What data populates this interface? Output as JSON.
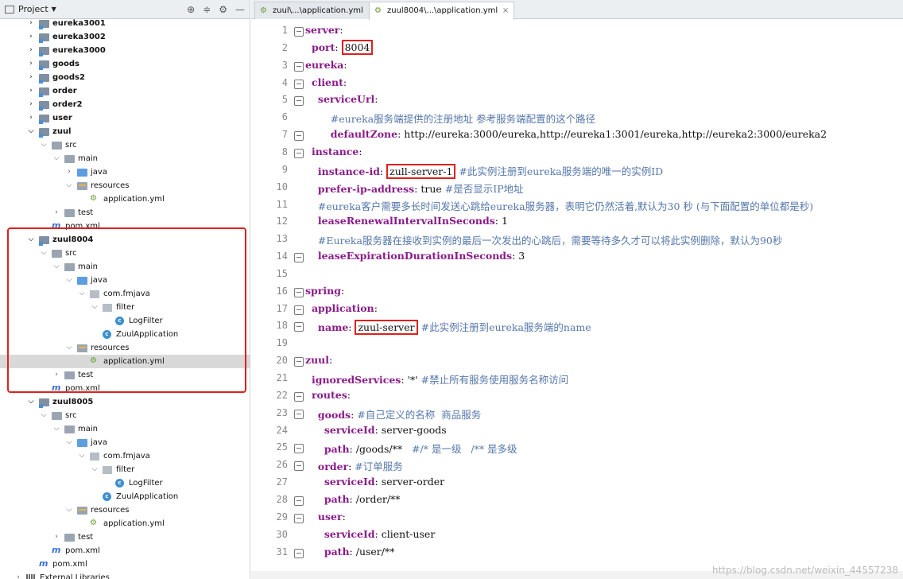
{
  "project_panel": {
    "title": "Project"
  },
  "tree": [
    {
      "label": "eureka3001",
      "depth": 1,
      "icon": "mod",
      "arrow": "right",
      "bold": true
    },
    {
      "label": "eureka3002",
      "depth": 1,
      "icon": "mod",
      "arrow": "right",
      "bold": true
    },
    {
      "label": "eureka3000",
      "depth": 1,
      "icon": "mod",
      "arrow": "right",
      "bold": true
    },
    {
      "label": "goods",
      "depth": 1,
      "icon": "mod",
      "arrow": "right",
      "bold": true
    },
    {
      "label": "goods2",
      "depth": 1,
      "icon": "mod",
      "arrow": "right",
      "bold": true
    },
    {
      "label": "order",
      "depth": 1,
      "icon": "mod",
      "arrow": "right",
      "bold": true
    },
    {
      "label": "order2",
      "depth": 1,
      "icon": "mod",
      "arrow": "right",
      "bold": true
    },
    {
      "label": "user",
      "depth": 1,
      "icon": "mod",
      "arrow": "right",
      "bold": true
    },
    {
      "label": "zuul",
      "depth": 1,
      "icon": "mod",
      "arrow": "down",
      "bold": true
    },
    {
      "label": "src",
      "depth": 2,
      "icon": "fold",
      "arrow": "down"
    },
    {
      "label": "main",
      "depth": 3,
      "icon": "fold",
      "arrow": "down"
    },
    {
      "label": "java",
      "depth": 4,
      "icon": "blue",
      "arrow": "right"
    },
    {
      "label": "resources",
      "depth": 4,
      "icon": "res",
      "arrow": "down"
    },
    {
      "label": "application.yml",
      "depth": 5,
      "icon": "yml",
      "arrow": ""
    },
    {
      "label": "test",
      "depth": 3,
      "icon": "fold",
      "arrow": "right"
    },
    {
      "label": "pom.xml",
      "depth": 2,
      "icon": "pom",
      "arrow": ""
    },
    {
      "label": "zuul8004",
      "depth": 1,
      "icon": "mod",
      "arrow": "down",
      "bold": true
    },
    {
      "label": "src",
      "depth": 2,
      "icon": "fold",
      "arrow": "down"
    },
    {
      "label": "main",
      "depth": 3,
      "icon": "fold",
      "arrow": "down"
    },
    {
      "label": "java",
      "depth": 4,
      "icon": "blue",
      "arrow": "down"
    },
    {
      "label": "com.fmjava",
      "depth": 5,
      "icon": "pkg",
      "arrow": "down"
    },
    {
      "label": "filter",
      "depth": 6,
      "icon": "pkg",
      "arrow": "down"
    },
    {
      "label": "LogFilter",
      "depth": 7,
      "icon": "cls",
      "arrow": ""
    },
    {
      "label": "ZuulApplication",
      "depth": 6,
      "icon": "cls",
      "arrow": ""
    },
    {
      "label": "resources",
      "depth": 4,
      "icon": "res",
      "arrow": "down"
    },
    {
      "label": "application.yml",
      "depth": 5,
      "icon": "yml",
      "arrow": "",
      "selected": true
    },
    {
      "label": "test",
      "depth": 3,
      "icon": "fold",
      "arrow": "right"
    },
    {
      "label": "pom.xml",
      "depth": 2,
      "icon": "pom",
      "arrow": ""
    },
    {
      "label": "zuul8005",
      "depth": 1,
      "icon": "mod",
      "arrow": "down",
      "bold": true
    },
    {
      "label": "src",
      "depth": 2,
      "icon": "fold",
      "arrow": "down"
    },
    {
      "label": "main",
      "depth": 3,
      "icon": "fold",
      "arrow": "down"
    },
    {
      "label": "java",
      "depth": 4,
      "icon": "blue",
      "arrow": "down"
    },
    {
      "label": "com.fmjava",
      "depth": 5,
      "icon": "pkg",
      "arrow": "down"
    },
    {
      "label": "filter",
      "depth": 6,
      "icon": "pkg",
      "arrow": "down"
    },
    {
      "label": "LogFilter",
      "depth": 7,
      "icon": "cls",
      "arrow": ""
    },
    {
      "label": "ZuulApplication",
      "depth": 6,
      "icon": "cls",
      "arrow": ""
    },
    {
      "label": "resources",
      "depth": 4,
      "icon": "res",
      "arrow": "down"
    },
    {
      "label": "application.yml",
      "depth": 5,
      "icon": "yml",
      "arrow": ""
    },
    {
      "label": "test",
      "depth": 3,
      "icon": "fold",
      "arrow": "right"
    },
    {
      "label": "pom.xml",
      "depth": 2,
      "icon": "pom",
      "arrow": ""
    },
    {
      "label": "pom.xml",
      "depth": 1,
      "icon": "pom",
      "arrow": ""
    },
    {
      "label": "External Libraries",
      "depth": 0,
      "icon": "lib",
      "arrow": "right"
    }
  ],
  "tabs": [
    {
      "label": "zuul\\...\\application.yml",
      "active": false
    },
    {
      "label": "zuul8004\\...\\application.yml",
      "active": true
    }
  ],
  "code_lines": [
    [
      [
        "k",
        "server"
      ],
      [
        "v",
        ":"
      ]
    ],
    [
      [
        "v",
        "  "
      ],
      [
        "k",
        "port"
      ],
      [
        "v",
        ": "
      ],
      [
        "bx",
        "8004"
      ]
    ],
    [
      [
        "k",
        "eureka"
      ],
      [
        "v",
        ":"
      ]
    ],
    [
      [
        "v",
        "  "
      ],
      [
        "k",
        "client"
      ],
      [
        "v",
        ":"
      ]
    ],
    [
      [
        "v",
        "    "
      ],
      [
        "k",
        "serviceUrl"
      ],
      [
        "v",
        ":"
      ]
    ],
    [
      [
        "v",
        "        "
      ],
      [
        "c",
        "#eureka服务端提供的注册地址 参考服务端配置的这个路径"
      ]
    ],
    [
      [
        "v",
        "        "
      ],
      [
        "k",
        "defaultZone"
      ],
      [
        "v",
        ": http://eureka:3000/eureka,http://eureka1:3001/eureka,http://eureka2:3000/eureka2"
      ]
    ],
    [
      [
        "v",
        "  "
      ],
      [
        "k",
        "instance"
      ],
      [
        "v",
        ":"
      ]
    ],
    [
      [
        "v",
        "    "
      ],
      [
        "k",
        "instance-id"
      ],
      [
        "v",
        ": "
      ],
      [
        "bx",
        "zull-server-1"
      ],
      [
        "v",
        " "
      ],
      [
        "c",
        "#此实例注册到eureka服务端的唯一的实例ID"
      ]
    ],
    [
      [
        "v",
        "    "
      ],
      [
        "k",
        "prefer-ip-address"
      ],
      [
        "v",
        ": true "
      ],
      [
        "c",
        "#是否显示IP地址"
      ]
    ],
    [
      [
        "v",
        "    "
      ],
      [
        "c",
        "#eureka客户需要多长时间发送心跳给eureka服务器，表明它仍然活着,默认为30 秒 (与下面配置的单位都是秒)"
      ]
    ],
    [
      [
        "v",
        "    "
      ],
      [
        "k",
        "leaseRenewalIntervalInSeconds"
      ],
      [
        "v",
        ": 1"
      ]
    ],
    [
      [
        "v",
        "    "
      ],
      [
        "c",
        "#Eureka服务器在接收到实例的最后一次发出的心跳后，需要等待多久才可以将此实例删除，默认为90秒"
      ]
    ],
    [
      [
        "v",
        "    "
      ],
      [
        "k",
        "leaseExpirationDurationInSeconds"
      ],
      [
        "v",
        ": 3"
      ]
    ],
    [
      [
        "v",
        ""
      ]
    ],
    [
      [
        "k",
        "spring"
      ],
      [
        "v",
        ":"
      ]
    ],
    [
      [
        "v",
        "  "
      ],
      [
        "k",
        "application"
      ],
      [
        "v",
        ":"
      ]
    ],
    [
      [
        "v",
        "    "
      ],
      [
        "k",
        "name"
      ],
      [
        "v",
        ": "
      ],
      [
        "bx",
        "zuul-server"
      ],
      [
        "v",
        " "
      ],
      [
        "c",
        "#此实例注册到eureka服务端的name"
      ]
    ],
    [
      [
        "v",
        ""
      ]
    ],
    [
      [
        "k",
        "zuul"
      ],
      [
        "v",
        ":"
      ]
    ],
    [
      [
        "v",
        "  "
      ],
      [
        "k",
        "ignoredServices"
      ],
      [
        "v",
        ": '*' "
      ],
      [
        "c",
        "#禁止所有服务使用服务名称访问"
      ]
    ],
    [
      [
        "v",
        "  "
      ],
      [
        "k",
        "routes"
      ],
      [
        "v",
        ":"
      ]
    ],
    [
      [
        "v",
        "    "
      ],
      [
        "k",
        "goods"
      ],
      [
        "v",
        ": "
      ],
      [
        "c",
        "#自己定义的名称  商品服务"
      ]
    ],
    [
      [
        "v",
        "      "
      ],
      [
        "k",
        "serviceId"
      ],
      [
        "v",
        ": server-goods"
      ]
    ],
    [
      [
        "v",
        "      "
      ],
      [
        "k",
        "path"
      ],
      [
        "v",
        ": /goods/**   "
      ],
      [
        "c",
        "#/* 是一级   /** 是多级"
      ]
    ],
    [
      [
        "v",
        "    "
      ],
      [
        "k",
        "order"
      ],
      [
        "v",
        ": "
      ],
      [
        "c",
        "#订单服务"
      ]
    ],
    [
      [
        "v",
        "      "
      ],
      [
        "k",
        "serviceId"
      ],
      [
        "v",
        ": server-order"
      ]
    ],
    [
      [
        "v",
        "      "
      ],
      [
        "k",
        "path"
      ],
      [
        "v",
        ": /order/**"
      ]
    ],
    [
      [
        "v",
        "    "
      ],
      [
        "k",
        "user"
      ],
      [
        "v",
        ":"
      ]
    ],
    [
      [
        "v",
        "      "
      ],
      [
        "k",
        "serviceId"
      ],
      [
        "v",
        ": client-user"
      ]
    ],
    [
      [
        "v",
        "      "
      ],
      [
        "k",
        "path"
      ],
      [
        "v",
        ": /user/**"
      ]
    ]
  ],
  "line_numbers": [
    "1",
    "2",
    "3",
    "4",
    "5",
    "6",
    "7",
    "8",
    "9",
    "10",
    "11",
    "12",
    "13",
    "14",
    "15",
    "16",
    "17",
    "18",
    "19",
    "20",
    "21",
    "22",
    "23",
    "24",
    "25",
    "26",
    "27",
    "28",
    "29",
    "30",
    "31"
  ],
  "watermark": "https://blog.csdn.net/weixin_44557238"
}
